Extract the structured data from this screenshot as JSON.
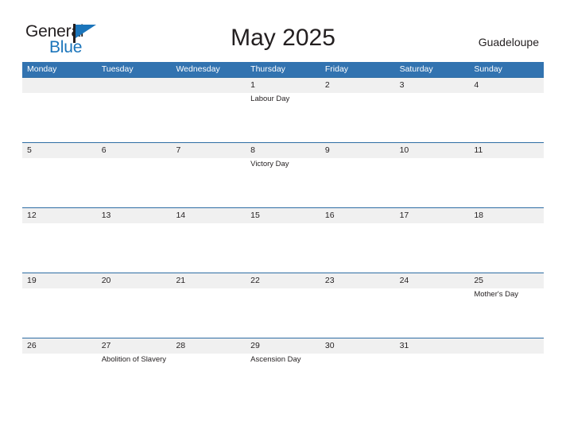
{
  "logo": {
    "word_one": "General",
    "word_two": "Blue",
    "flag_icon": "flag-triangle-icon",
    "brand_color": "#1B75BB"
  },
  "header": {
    "title": "May 2025",
    "location": "Guadeloupe"
  },
  "theme": {
    "header_blue": "#3273B0",
    "divider_blue": "#2E6DA4",
    "band_gray": "#F0F0F0",
    "text_color": "#231F20"
  },
  "calendar": {
    "weekdays": [
      "Monday",
      "Tuesday",
      "Wednesday",
      "Thursday",
      "Friday",
      "Saturday",
      "Sunday"
    ],
    "weeks": [
      [
        {
          "day": "",
          "event": ""
        },
        {
          "day": "",
          "event": ""
        },
        {
          "day": "",
          "event": ""
        },
        {
          "day": "1",
          "event": "Labour Day"
        },
        {
          "day": "2",
          "event": ""
        },
        {
          "day": "3",
          "event": ""
        },
        {
          "day": "4",
          "event": ""
        }
      ],
      [
        {
          "day": "5",
          "event": ""
        },
        {
          "day": "6",
          "event": ""
        },
        {
          "day": "7",
          "event": ""
        },
        {
          "day": "8",
          "event": "Victory Day"
        },
        {
          "day": "9",
          "event": ""
        },
        {
          "day": "10",
          "event": ""
        },
        {
          "day": "11",
          "event": ""
        }
      ],
      [
        {
          "day": "12",
          "event": ""
        },
        {
          "day": "13",
          "event": ""
        },
        {
          "day": "14",
          "event": ""
        },
        {
          "day": "15",
          "event": ""
        },
        {
          "day": "16",
          "event": ""
        },
        {
          "day": "17",
          "event": ""
        },
        {
          "day": "18",
          "event": ""
        }
      ],
      [
        {
          "day": "19",
          "event": ""
        },
        {
          "day": "20",
          "event": ""
        },
        {
          "day": "21",
          "event": ""
        },
        {
          "day": "22",
          "event": ""
        },
        {
          "day": "23",
          "event": ""
        },
        {
          "day": "24",
          "event": ""
        },
        {
          "day": "25",
          "event": "Mother's Day"
        }
      ],
      [
        {
          "day": "26",
          "event": ""
        },
        {
          "day": "27",
          "event": "Abolition of Slavery"
        },
        {
          "day": "28",
          "event": ""
        },
        {
          "day": "29",
          "event": "Ascension Day"
        },
        {
          "day": "30",
          "event": ""
        },
        {
          "day": "31",
          "event": ""
        },
        {
          "day": "",
          "event": ""
        }
      ]
    ]
  }
}
